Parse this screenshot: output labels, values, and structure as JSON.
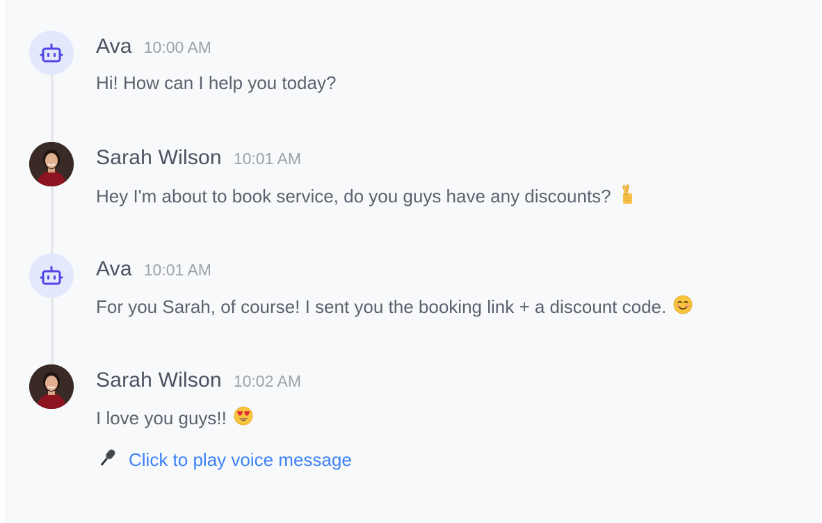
{
  "messages": [
    {
      "sender": "Ava",
      "time": "10:00 AM",
      "text": "Hi! How can I help you today?",
      "avatar": "robot-icon",
      "emoji": ""
    },
    {
      "sender": "Sarah Wilson",
      "time": "10:01 AM",
      "text": "Hey I'm about to book service, do you guys have any discounts?",
      "avatar": "user-photo",
      "emoji": "crossed-fingers-emoji"
    },
    {
      "sender": "Ava",
      "time": "10:01 AM",
      "text": "For you Sarah, of course! I sent you the booking link + a discount code.",
      "avatar": "robot-icon",
      "emoji": "smiling-face-emoji"
    },
    {
      "sender": "Sarah Wilson",
      "time": "10:02 AM",
      "text": "I love you guys!!",
      "avatar": "user-photo",
      "emoji": "heart-eyes-emoji"
    }
  ],
  "voice_message": {
    "icon": "microphone-icon",
    "label": "Click to play voice message"
  },
  "colors": {
    "background": "#f8f9fb",
    "bot_avatar_bg": "#e3e8fc",
    "bot_icon": "#4f46e5",
    "name": "#4b5160",
    "timestamp": "#9ca1ab",
    "message_text": "#5c616d",
    "link": "#3c82f6"
  }
}
